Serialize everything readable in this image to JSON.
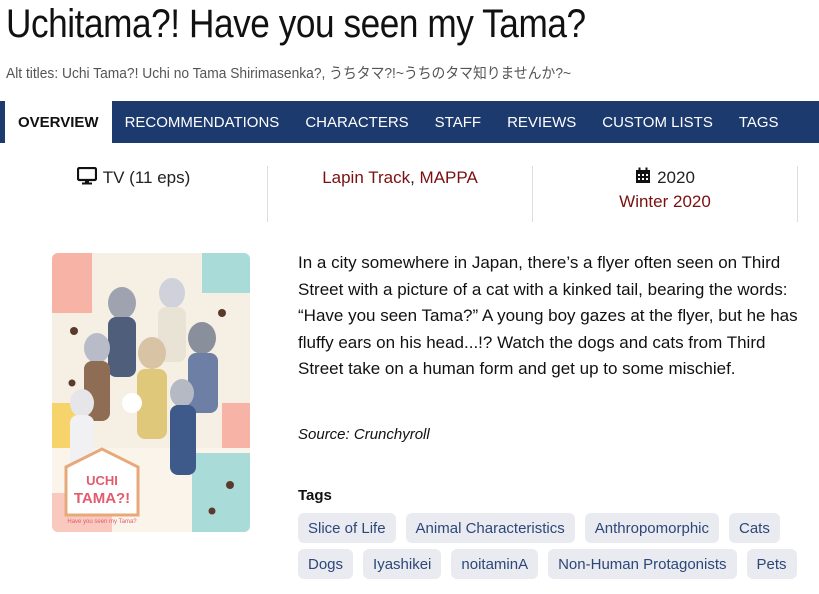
{
  "header": {
    "title": "Uchitama?! Have you seen my Tama?",
    "alt_titles_label": "Alt titles: ",
    "alt_titles": "Uchi Tama?! Uchi no Tama Shirimasenka?, うちタマ?!~うちのタマ知りませんか?~"
  },
  "tabs": [
    {
      "label": "OVERVIEW",
      "active": true
    },
    {
      "label": "RECOMMENDATIONS"
    },
    {
      "label": "CHARACTERS"
    },
    {
      "label": "STAFF"
    },
    {
      "label": "REVIEWS"
    },
    {
      "label": "CUSTOM LISTS"
    },
    {
      "label": "TAGS"
    }
  ],
  "info": {
    "format": "TV (11 eps)",
    "format_icon": "monitor-icon",
    "studio_1": "Lapin Track",
    "studio_sep": ", ",
    "studio_2": "MAPPA",
    "year": "2020",
    "year_icon": "calendar-icon",
    "season": "Winter 2020"
  },
  "poster": {
    "logo_line1": "UCHI",
    "logo_line2": "TAMA?!",
    "logo_subtitle": "Have you seen my Tama?"
  },
  "synopsis": "In a city somewhere in Japan, there’s a flyer often seen on Third Street with a picture of a cat with a kinked tail, bearing the words: “Have you seen Tama?” A young boy gazes at the flyer, but he has fluffy ears on his head...!? Watch the dogs and cats from Third Street take on a human form and get up to some mischief.",
  "source": "Source: Crunchyroll",
  "tags_heading": "Tags",
  "tags": [
    "Slice of Life",
    "Animal Characteristics",
    "Anthropomorphic",
    "Cats",
    "Dogs",
    "Iyashikei",
    "noitaminA",
    "Non-Human Protagonists",
    "Pets"
  ],
  "colors": {
    "nav_bg": "#1d3a6e",
    "link": "#7a1010",
    "tag_bg": "#e9ebf0",
    "tag_text": "#2c4778"
  }
}
